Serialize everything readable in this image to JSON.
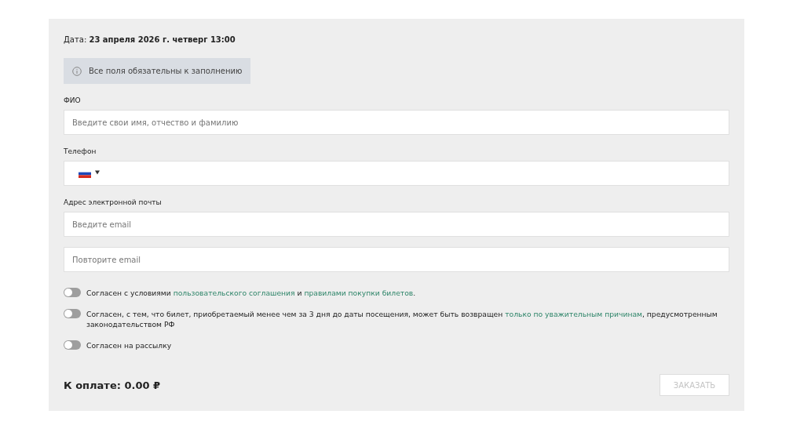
{
  "date": {
    "label": "Дата:",
    "value": "23 апреля 2026 г. четверг 13:00"
  },
  "notice": {
    "text": "Все поля обязательны к заполнению"
  },
  "fields": [
    {
      "kind": "text",
      "label": "ФИО",
      "placeholder": "Введите свои имя, отчество и фамилию"
    },
    {
      "kind": "phone",
      "label": "Телефон"
    },
    {
      "kind": "text",
      "label": "Адрес электронной почты",
      "placeholder": "Введите email"
    },
    {
      "kind": "text",
      "placeholder": "Повторите email"
    }
  ],
  "consents": [
    {
      "on": false,
      "parts": [
        {
          "text": "Согласен с условиями ",
          "link": false
        },
        {
          "text": "пользовательского соглашения",
          "link": true
        },
        {
          "text": " и ",
          "link": false
        },
        {
          "text": "правилами покупки билетов",
          "link": true
        },
        {
          "text": ".",
          "link": false
        }
      ]
    },
    {
      "on": false,
      "parts": [
        {
          "text": "Согласен, с тем, что билет, приобретаемый менее чем за 3 дня до даты посещения, может быть возвращен ",
          "link": false
        },
        {
          "text": "только по уважительным причинам",
          "link": true
        },
        {
          "text": ", предусмотренным законодательством РФ",
          "link": false
        }
      ]
    },
    {
      "on": false,
      "parts": [
        {
          "text": "Согласен на рассылку",
          "link": false
        }
      ]
    }
  ],
  "total": {
    "text": "К оплате: 0.00 ₽"
  },
  "order_button": {
    "label": "ЗАКАЗАТЬ",
    "disabled": true
  }
}
